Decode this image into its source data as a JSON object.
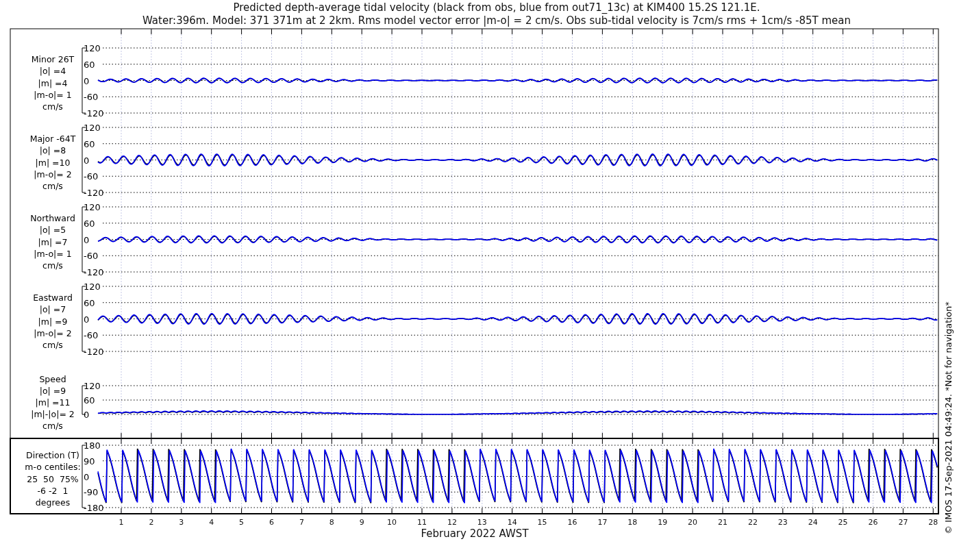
{
  "title": [
    "Predicted depth-average tidal velocity (black from obs, blue from out71_13c) at KIM400 15.2S 121.1E.",
    "Water:396m. Model: 371 371m at 2 2km. Rms model vector error |m-o| = 2 cm/s. Obs sub-tidal velocity is 7cm/s rms + 1cm/s -85T mean"
  ],
  "panels": [
    {
      "kind": "velocity",
      "label": [
        "Minor 26T",
        "|o| =4",
        "|m| =4",
        "|m-o|= 1",
        "cm/s"
      ],
      "yticks": [
        "120",
        "60",
        "0",
        "-60",
        "-120"
      ]
    },
    {
      "kind": "velocity",
      "label": [
        "Major -64T",
        "|o| =8",
        "|m| =10",
        "|m-o|= 2",
        "cm/s"
      ],
      "yticks": [
        "120",
        "60",
        "0",
        "-60",
        "-120"
      ]
    },
    {
      "kind": "velocity",
      "label": [
        "Northward",
        "|o| =5",
        "|m| =7",
        "|m-o|= 1",
        "cm/s"
      ],
      "yticks": [
        "120",
        "60",
        "0",
        "-60",
        "-120"
      ]
    },
    {
      "kind": "velocity",
      "label": [
        "Eastward",
        "|o| =7",
        "|m| =9",
        "|m-o|= 2",
        "cm/s"
      ],
      "yticks": [
        "120",
        "60",
        "0",
        "-60",
        "-120"
      ]
    },
    {
      "kind": "speed",
      "label": [
        "Speed",
        "|o| =9",
        "|m| =11",
        "|m|-|o|= 2",
        "cm/s"
      ],
      "yticks": [
        "120",
        "60",
        "0"
      ]
    },
    {
      "kind": "direction",
      "label": [
        "Direction (T)",
        "m-o centiles:",
        "25  50  75%",
        "-6 -2  1",
        "degrees"
      ],
      "yticks": [
        "180",
        "90",
        "0",
        "-90",
        "-180"
      ]
    }
  ],
  "days": [
    "1",
    "2",
    "3",
    "4",
    "5",
    "6",
    "7",
    "8",
    "9",
    "10",
    "11",
    "12",
    "13",
    "14",
    "15",
    "16",
    "17",
    "18",
    "19",
    "20",
    "21",
    "22",
    "23",
    "24",
    "25",
    "26",
    "27",
    "28"
  ],
  "xlabel": "February 2022 AWST",
  "credit": "© IMOS 17-Sep-2021 04:49:24. *Not for navigation*"
}
